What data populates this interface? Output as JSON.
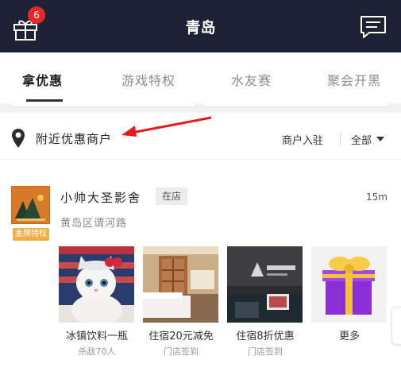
{
  "header": {
    "title": "青岛",
    "badge_count": "6",
    "colors": {
      "bar": "#1e2035",
      "badge": "#e02a2a"
    }
  },
  "tabs": [
    {
      "label": "拿优惠",
      "active": true
    },
    {
      "label": "游戏特权",
      "active": false
    },
    {
      "label": "水友赛",
      "active": false
    },
    {
      "label": "聚会开黑",
      "active": false
    }
  ],
  "nearby": {
    "title": "附近优惠商户",
    "merchant_join": "商户入驻",
    "filter": "全部"
  },
  "merchant": {
    "name": "小帅大圣影舍",
    "tag": "在店",
    "distance": "15m",
    "address": "黄岛区谓河路",
    "gold_badge": "金牌特权"
  },
  "offers": [
    {
      "title": "冰镇饮料一瓶",
      "subtitle": "杀敌70人",
      "image": "cat-photo"
    },
    {
      "title": "住宿20元减免",
      "subtitle": "门店签到",
      "image": "hotel-room-photo"
    },
    {
      "title": "住宿8折优惠",
      "subtitle": "门店签到",
      "image": "lobby-photo"
    },
    {
      "title": "更多",
      "subtitle": "",
      "image": "gift-box-icon"
    }
  ]
}
